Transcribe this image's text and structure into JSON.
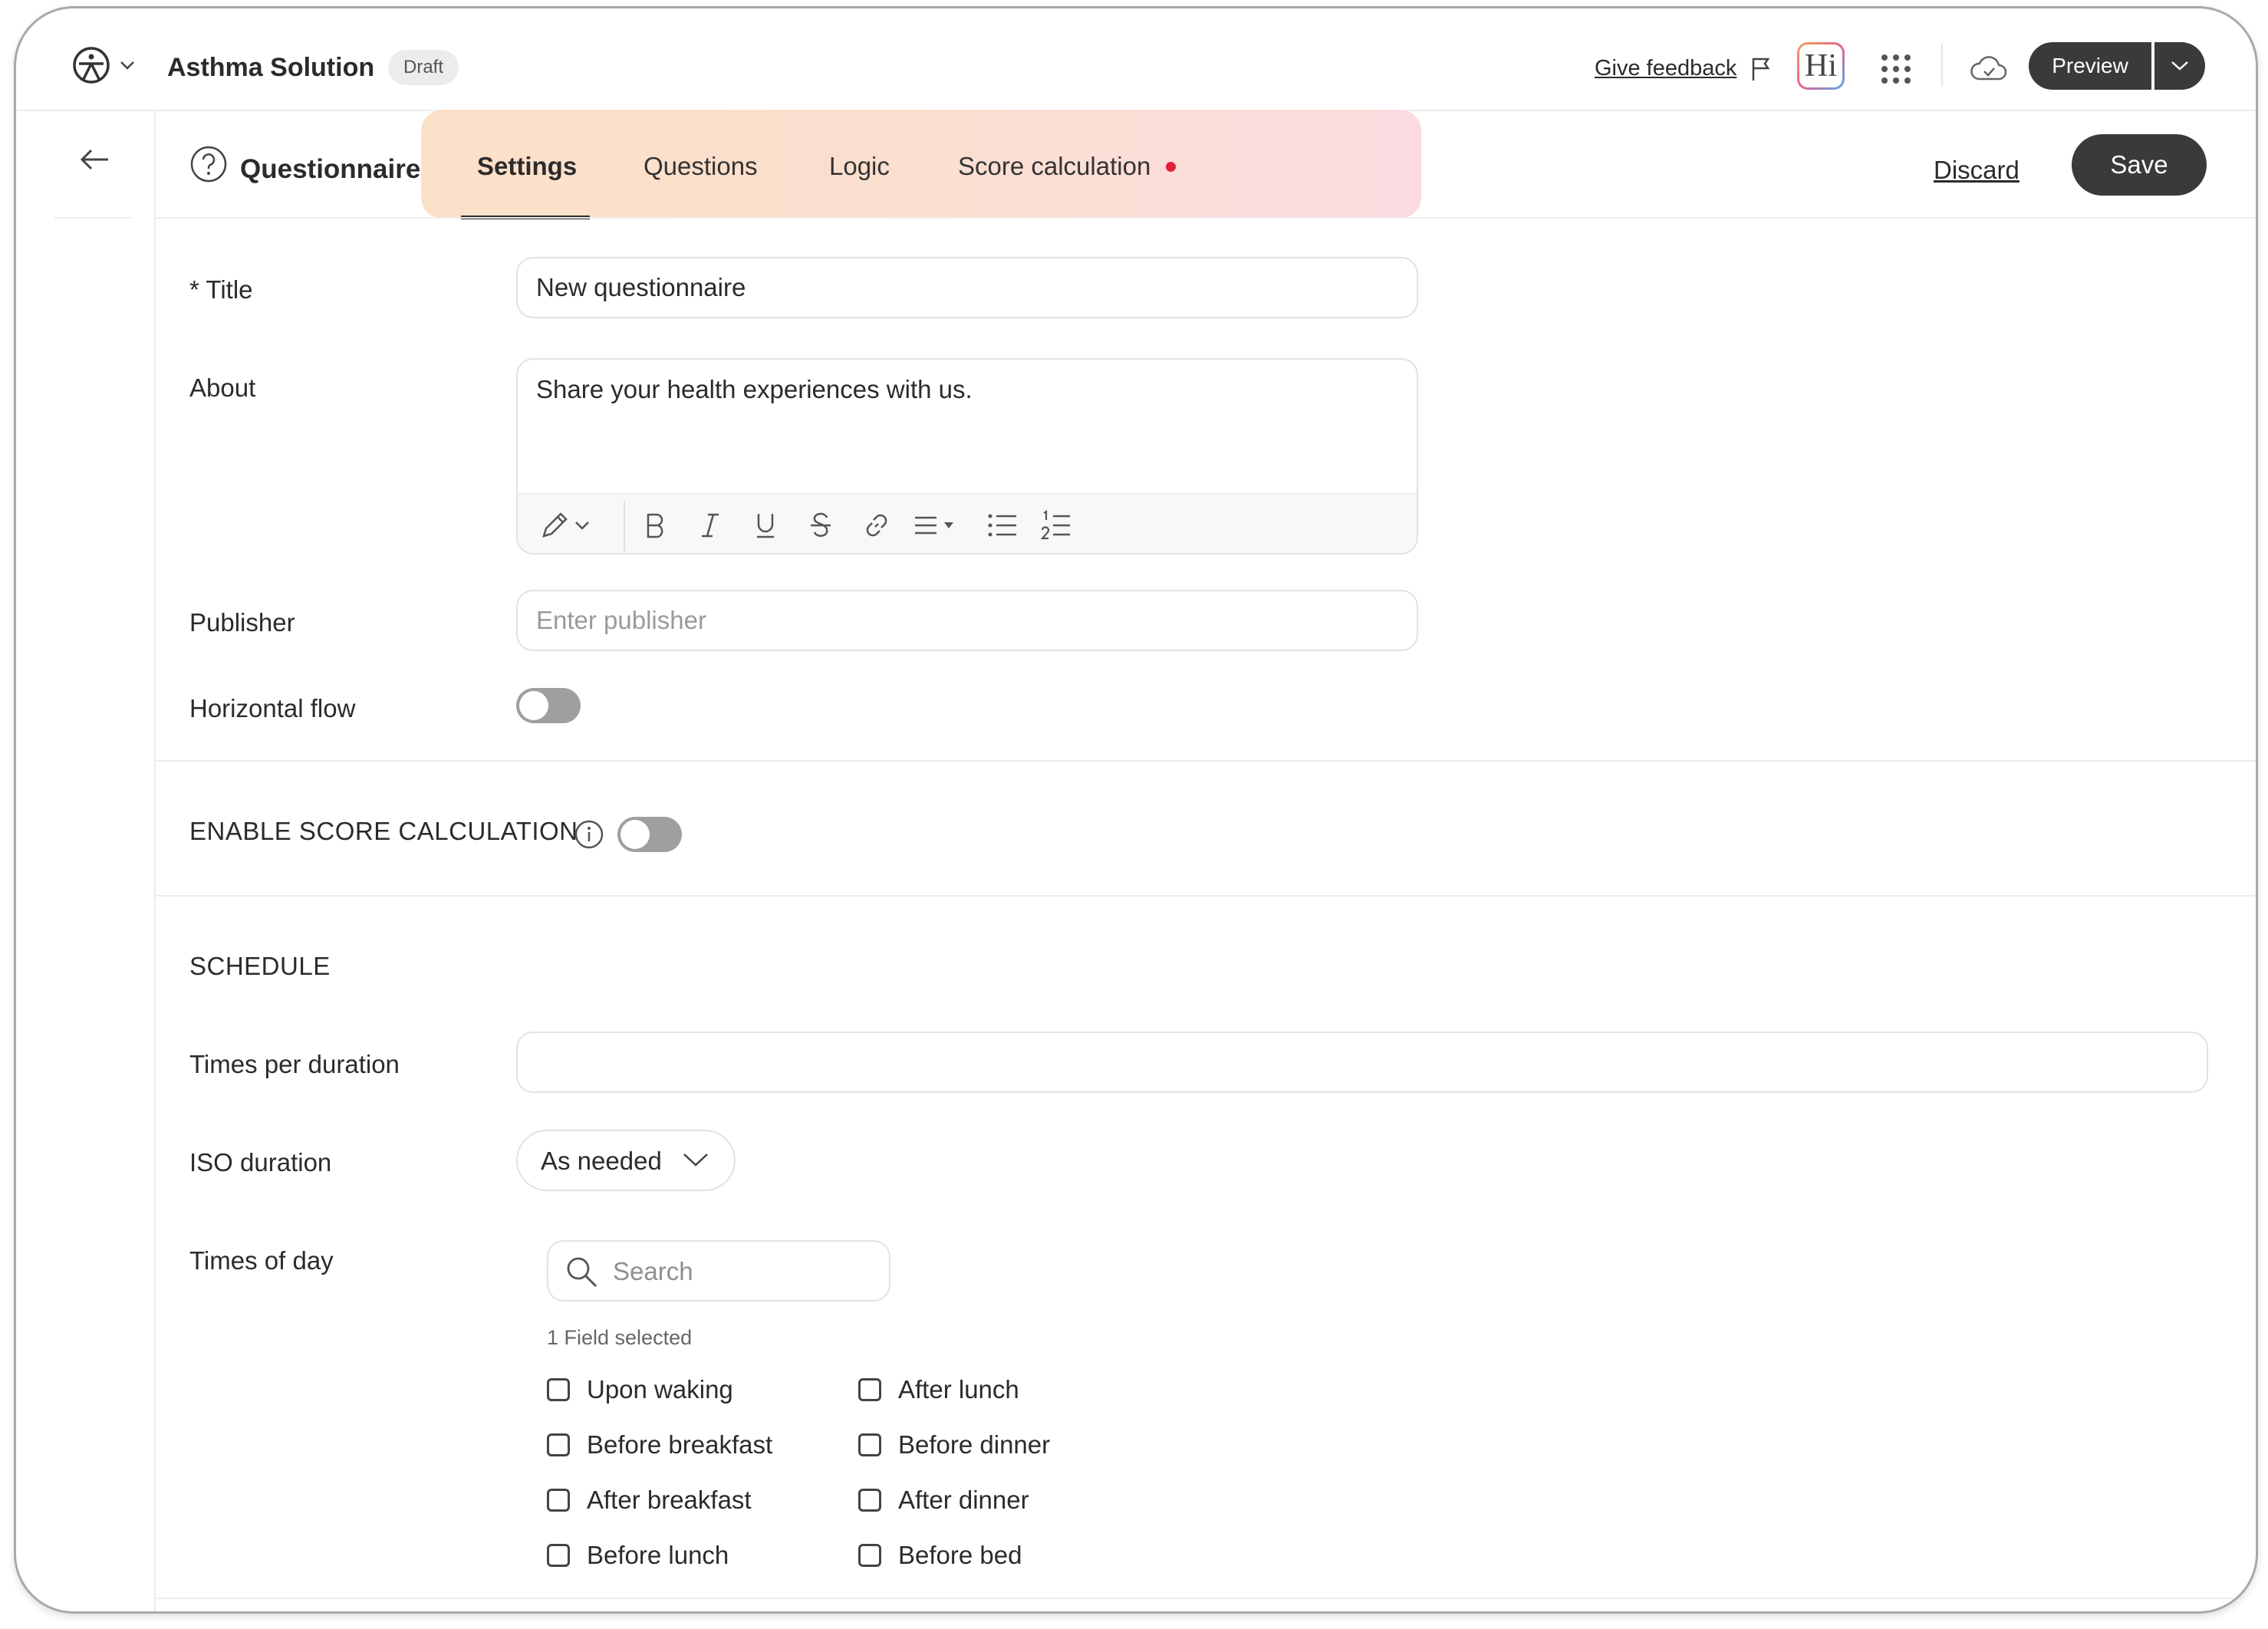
{
  "app": {
    "title": "Asthma Solution",
    "status_badge": "Draft"
  },
  "topbar": {
    "feedback_label": "Give feedback",
    "hi_label": "Hi",
    "preview_label": "Preview"
  },
  "editor_header": {
    "title": "Questionnaire",
    "tabs": [
      {
        "label": "Settings",
        "active": true
      },
      {
        "label": "Questions",
        "active": false
      },
      {
        "label": "Logic",
        "active": false
      },
      {
        "label": "Score calculation",
        "active": false,
        "has_indicator": true
      }
    ],
    "discard_label": "Discard",
    "save_label": "Save"
  },
  "form": {
    "title_label": "* Title",
    "title_value": "New questionnaire",
    "about_label": "About",
    "about_value": "Share your health experiences with us.",
    "publisher_label": "Publisher",
    "publisher_placeholder": "Enter publisher",
    "horizontal_flow_label": "Horizontal flow",
    "horizontal_flow_on": false
  },
  "score": {
    "label": "ENABLE SCORE CALCULATION",
    "enabled": false
  },
  "schedule": {
    "heading": "SCHEDULE",
    "times_per_duration_label": "Times per duration",
    "times_per_duration_value": "",
    "iso_duration_label": "ISO duration",
    "iso_duration_value": "As needed",
    "times_of_day_label": "Times of day",
    "search_placeholder": "Search",
    "selected_count": "1 Field selected",
    "options_col1": [
      "Upon waking",
      "Before breakfast",
      "After breakfast",
      "Before lunch"
    ],
    "options_col2": [
      "After lunch",
      "Before dinner",
      "After dinner",
      "Before bed"
    ]
  },
  "icons": [
    "app-logo-icon",
    "chevron-down-icon",
    "flag-icon",
    "apps-grid-icon",
    "cloud-icon",
    "back-arrow-icon",
    "help-circle-icon",
    "pen-icon",
    "bold-icon",
    "italic-icon",
    "underline-icon",
    "strikethrough-icon",
    "link-icon",
    "align-icon",
    "bullet-list-icon",
    "numbered-list-icon",
    "info-icon",
    "search-icon"
  ],
  "colors": {
    "primary_dark": "#3a3a3a",
    "indicator_red": "#e0223b",
    "tab_gradient_start": "#fbe0c9",
    "tab_gradient_end": "#fbdbe0"
  }
}
